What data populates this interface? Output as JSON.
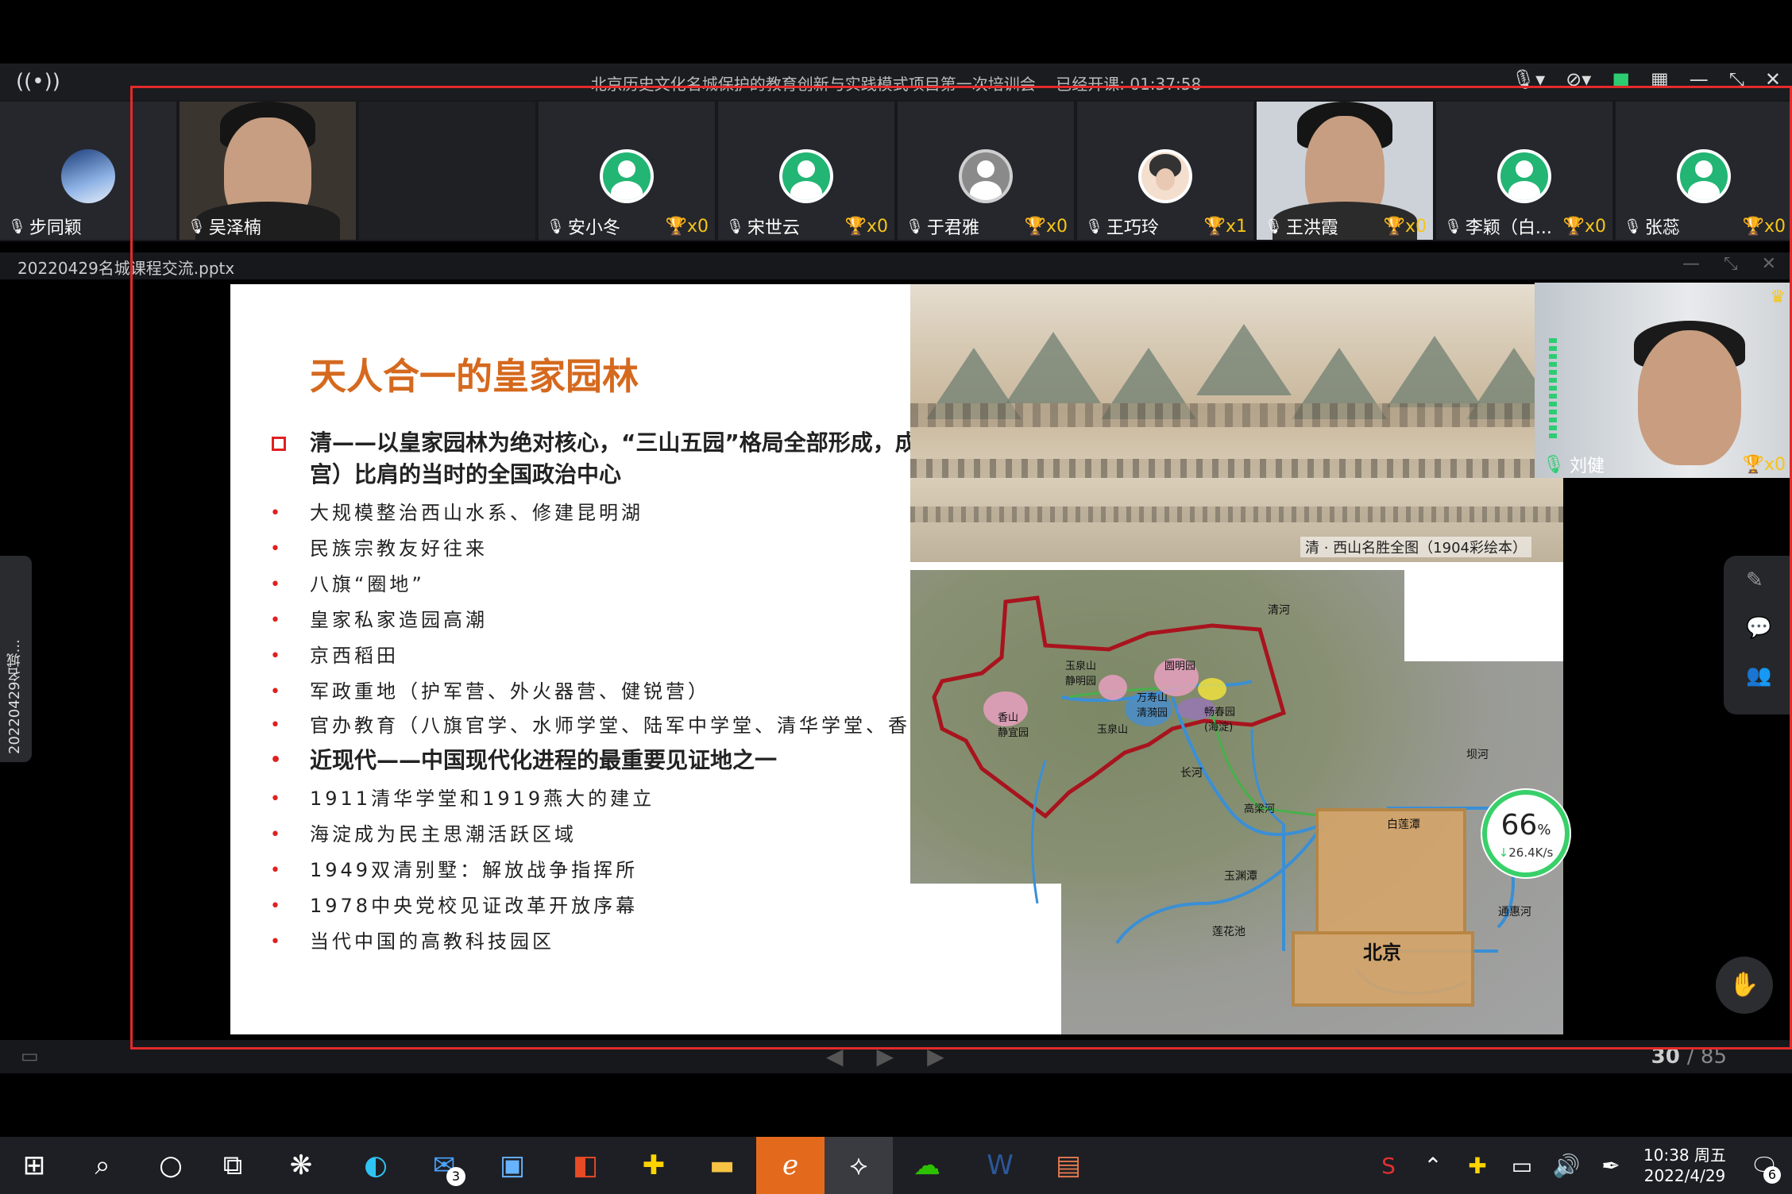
{
  "window": {
    "title": "北京历史文化名城保护的教育创新与实践模式项目第一次培训会",
    "status": "已经开课: 01:37:58"
  },
  "participants": [
    {
      "name": "步同颖",
      "type": "avatar-globe",
      "trophy": ""
    },
    {
      "name": "吴泽楠",
      "type": "video",
      "trophy": ""
    },
    {
      "name": "",
      "type": "empty",
      "trophy": ""
    },
    {
      "name": "安小冬",
      "type": "avatar",
      "trophy": "x0"
    },
    {
      "name": "宋世云",
      "type": "avatar",
      "trophy": "x0"
    },
    {
      "name": "于君雅",
      "type": "avatar-cam",
      "trophy": "x0"
    },
    {
      "name": "王巧玲",
      "type": "avatar-person",
      "trophy": "x1"
    },
    {
      "name": "王洪霞",
      "type": "video-light",
      "trophy": "x0"
    },
    {
      "name": "李颖（白...",
      "type": "avatar",
      "trophy": "x0"
    },
    {
      "name": "张蕊",
      "type": "avatar",
      "trophy": "x0"
    }
  ],
  "file": {
    "name": "20220429名城课程交流.pptx",
    "side_tab": "20220429名城..."
  },
  "slide": {
    "heading": "天人合一的皇家园林",
    "main_point": "清——以皇家园林为绝对核心，“三山五园”格局全部形成，成为与紫禁城（故宫）比肩的当时的全国政治中心",
    "bullets_qing": [
      "大规模整治西山水系、修建昆明湖",
      "民族宗教友好往来",
      "八旗“圈地”",
      "皇家私家造园高潮",
      "京西稻田",
      "军政重地（护军营、外火器营、健锐营）",
      "官办教育（八旗官学、水师学堂、陆军中学堂、清华学堂、香山慈幼院）"
    ],
    "modern_point": "近现代——中国现代化进程的最重要见证地之一",
    "bullets_modern": [
      "1911清华学堂和1919燕大的建立",
      "海淀成为民主思潮活跃区域",
      "1949双清别墅：解放战争指挥所",
      "1978中央党校见证改革开放序幕",
      "当代中国的高教科技园区"
    ],
    "painting_caption": "清 · 西山名胜全图（1904彩绘本）",
    "map_labels": {
      "beijing": "北京",
      "yuquan": "玉泉山\n静明园",
      "yuanming": "圆明园",
      "wanshou": "万寿山\n清漪园",
      "xiangshan": "香山\n静宜园",
      "changchun": "畅春园\n(海淀)",
      "yuquanshan": "玉泉山",
      "qinghe": "清河",
      "bahe": "坝河",
      "tonghui": "通惠河",
      "bailian": "白莲潭",
      "yuyuan": "玉渊潭",
      "lianhua": "莲花池",
      "gaoliang": "高梁河",
      "changhe": "长河"
    }
  },
  "presenter": {
    "name": "刘健",
    "trophy": "x0"
  },
  "network": {
    "percent": "66",
    "unit": "%",
    "speed": "26.4K/s"
  },
  "pager": {
    "current": "30",
    "total": "/ 85"
  },
  "taskbar": {
    "clock_time": "10:38 周五",
    "clock_date": "2022/4/29",
    "mail_badge": "3",
    "notif_count": "6"
  }
}
